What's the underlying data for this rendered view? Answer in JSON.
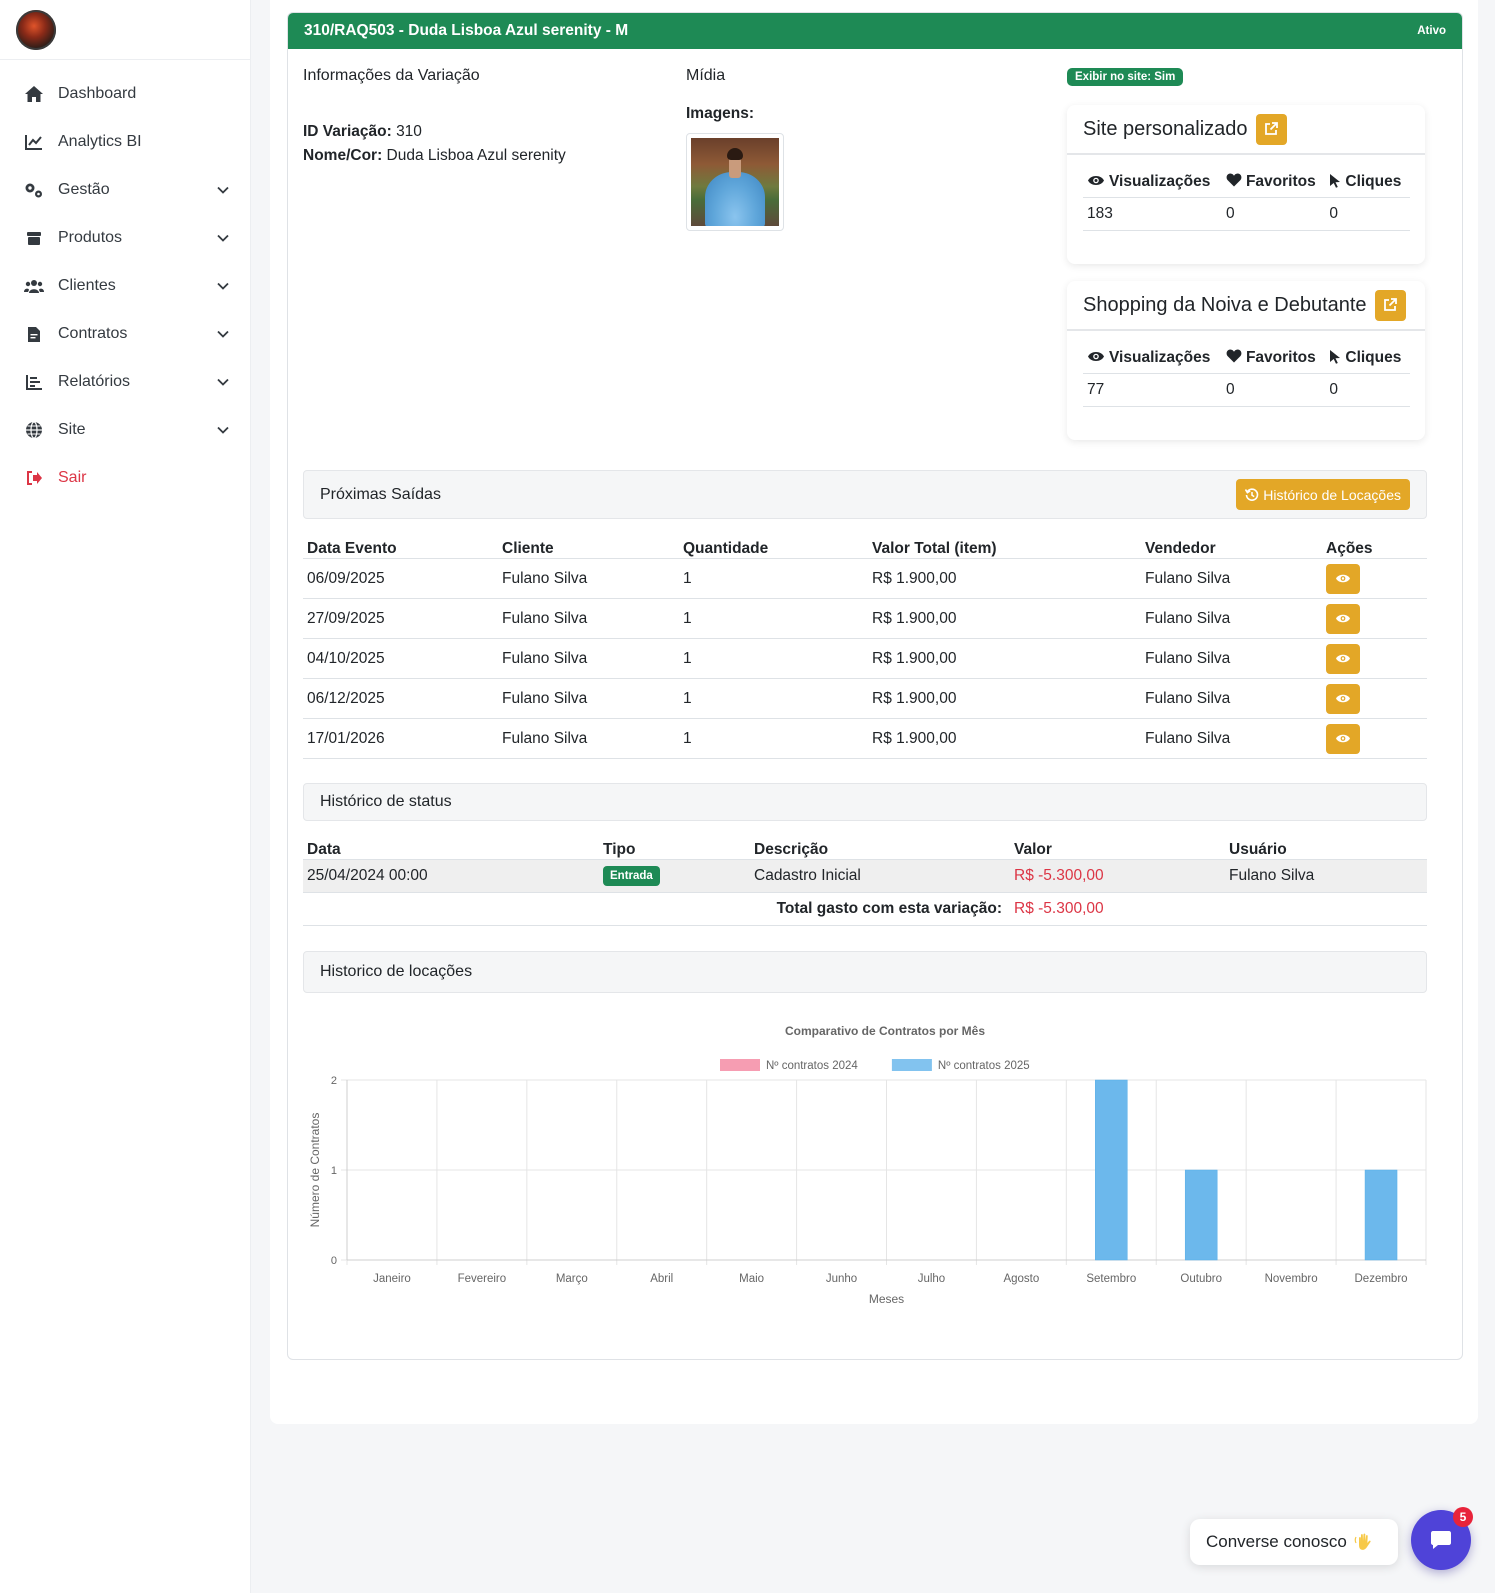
{
  "sidebar": {
    "items": [
      {
        "label": "Dashboard",
        "icon": "home-icon",
        "has_children": false
      },
      {
        "label": "Analytics BI",
        "icon": "chart-line-icon",
        "has_children": false
      },
      {
        "label": "Gestão",
        "icon": "gears-icon",
        "has_children": true
      },
      {
        "label": "Produtos",
        "icon": "box-icon",
        "has_children": true
      },
      {
        "label": "Clientes",
        "icon": "users-icon",
        "has_children": true
      },
      {
        "label": "Contratos",
        "icon": "file-contract-icon",
        "has_children": true
      },
      {
        "label": "Relatórios",
        "icon": "chart-bars-icon",
        "has_children": true
      },
      {
        "label": "Site",
        "icon": "globe-icon",
        "has_children": true
      }
    ],
    "logout_label": "Sair"
  },
  "header": {
    "title": "310/RAQ503 - Duda Lisboa Azul serenity - M",
    "status": "Ativo",
    "color": "#1e8a55"
  },
  "info": {
    "section_title": "Informações da Variação",
    "id_label": "ID Variação:",
    "id_value": "310",
    "name_label": "Nome/Cor:",
    "name_value": "Duda Lisboa Azul serenity"
  },
  "media": {
    "section_title": "Mídia",
    "images_label": "Imagens:"
  },
  "site_badge": "Exibir no site: Sim",
  "stats": [
    {
      "title": "Site personalizado",
      "headers": [
        "Visualizações",
        "Favoritos",
        "Cliques"
      ],
      "values": [
        "183",
        "0",
        "0"
      ]
    },
    {
      "title": "Shopping da Noiva e Debutante",
      "headers": [
        "Visualizações",
        "Favoritos",
        "Cliques"
      ],
      "values": [
        "77",
        "0",
        "0"
      ]
    }
  ],
  "proximas": {
    "title": "Próximas Saídas",
    "history_button": "Histórico de Locações",
    "columns": [
      "Data Evento",
      "Cliente",
      "Quantidade",
      "Valor Total (item)",
      "Vendedor",
      "Ações"
    ],
    "rows": [
      [
        "06/09/2025",
        "Fulano Silva",
        "1",
        "R$ 1.900,00",
        "Fulano Silva"
      ],
      [
        "27/09/2025",
        "Fulano Silva",
        "1",
        "R$ 1.900,00",
        "Fulano Silva"
      ],
      [
        "04/10/2025",
        "Fulano Silva",
        "1",
        "R$ 1.900,00",
        "Fulano Silva"
      ],
      [
        "06/12/2025",
        "Fulano Silva",
        "1",
        "R$ 1.900,00",
        "Fulano Silva"
      ],
      [
        "17/01/2026",
        "Fulano Silva",
        "1",
        "R$ 1.900,00",
        "Fulano Silva"
      ]
    ]
  },
  "status_history": {
    "title": "Histórico de status",
    "columns": [
      "Data",
      "Tipo",
      "Descrição",
      "Valor",
      "Usuário"
    ],
    "rows": [
      [
        "25/04/2024 00:00",
        "Entrada",
        "Cadastro Inicial",
        "R$ -5.300,00",
        "Fulano Silva"
      ]
    ],
    "total_label": "Total gasto com esta variação:",
    "total_value": "R$ -5.300,00"
  },
  "locacoes": {
    "title": "Historico de locações"
  },
  "chart_data": {
    "type": "bar",
    "title": "Comparativo de Contratos por Mês",
    "xlabel": "Meses",
    "ylabel": "Número de Contratos",
    "categories": [
      "Janeiro",
      "Fevereiro",
      "Março",
      "Abril",
      "Maio",
      "Junho",
      "Julho",
      "Agosto",
      "Setembro",
      "Outubro",
      "Novembro",
      "Dezembro"
    ],
    "series": [
      {
        "name": "Nº contratos 2024",
        "color": "#f58ca4",
        "values": [
          0,
          0,
          0,
          0,
          0,
          0,
          0,
          0,
          0,
          0,
          0,
          0
        ]
      },
      {
        "name": "Nº contratos 2025",
        "color": "#6cb8ec",
        "values": [
          0,
          0,
          0,
          0,
          0,
          0,
          0,
          0,
          2,
          1,
          0,
          1
        ]
      }
    ],
    "ylim": [
      0,
      2
    ],
    "yticks": [
      0,
      1,
      2
    ],
    "grid": true,
    "legend": "top-center"
  },
  "chat": {
    "label": "Converse conosco",
    "count": "5"
  }
}
